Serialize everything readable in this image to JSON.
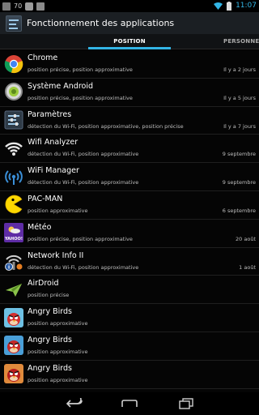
{
  "statusbar": {
    "battery_level": "70",
    "time": "11:07",
    "accent": "#33b5e5"
  },
  "actionbar": {
    "title": "Fonctionnement des applications"
  },
  "tabs": [
    {
      "label": "POSITION",
      "selected": true
    },
    {
      "label": "PERSONNEL",
      "selected": false
    }
  ],
  "apps": [
    {
      "name": "Chrome",
      "permissions": "position précise, position approximative",
      "last_used": "Il y a 2 jours",
      "icon": "chrome-icon"
    },
    {
      "name": "Système Android",
      "permissions": "position précise, position approximative",
      "last_used": "Il y a 5 jours",
      "icon": "android-system-icon"
    },
    {
      "name": "Paramètres",
      "permissions": "détection du Wi-Fi, position approximative, position précise",
      "last_used": "Il y a 7 jours",
      "icon": "settings-icon"
    },
    {
      "name": "Wifi Analyzer",
      "permissions": "détection du Wi-Fi, position approximative",
      "last_used": "9 septembre",
      "icon": "wifi-analyzer-icon"
    },
    {
      "name": "WiFi Manager",
      "permissions": "détection du Wi-Fi, position approximative",
      "last_used": "9 septembre",
      "icon": "wifi-manager-icon"
    },
    {
      "name": "PAC-MAN",
      "permissions": "position approximative",
      "last_used": "6 septembre",
      "icon": "pacman-icon"
    },
    {
      "name": "Météo",
      "permissions": "position précise, position approximative",
      "last_used": "20 août",
      "icon": "yahoo-weather-icon",
      "icon_text": "YAHOO!"
    },
    {
      "name": "Network Info II",
      "permissions": "détection du Wi-Fi, position approximative",
      "last_used": "1 août",
      "icon": "network-info-icon"
    },
    {
      "name": "AirDroid",
      "permissions": "position précise",
      "last_used": "",
      "icon": "airdroid-icon"
    },
    {
      "name": "Angry Birds",
      "permissions": "position approximative",
      "last_used": "",
      "icon": "angry-birds-icon"
    },
    {
      "name": "Angry Birds",
      "permissions": "position approximative",
      "last_used": "",
      "icon": "angry-birds-icon"
    },
    {
      "name": "Angry Birds",
      "permissions": "position approximative",
      "last_used": "",
      "icon": "angry-birds-icon"
    }
  ]
}
